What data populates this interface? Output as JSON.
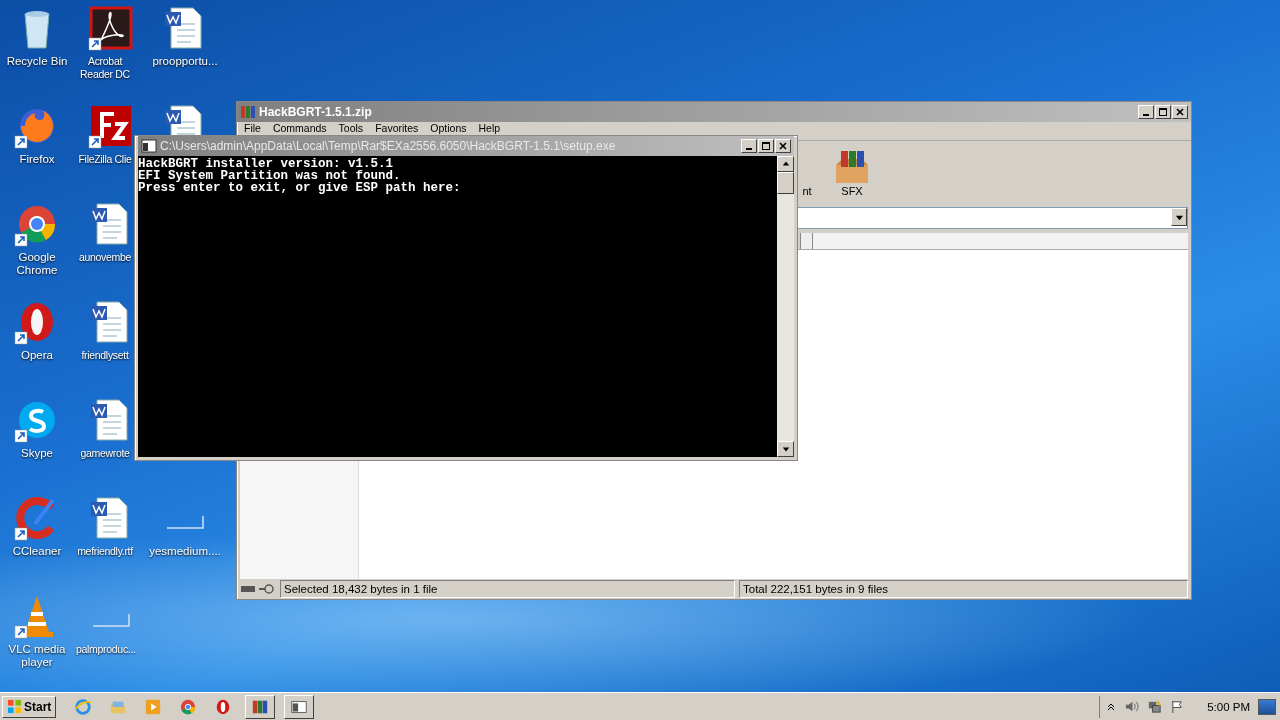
{
  "desktop": {
    "columns": [
      [
        {
          "kind": "recycle",
          "label": "Recycle Bin",
          "shortcut": false
        },
        {
          "kind": "firefox",
          "label": "Firefox",
          "shortcut": true
        },
        {
          "kind": "chrome",
          "label": "Google Chrome",
          "shortcut": true
        },
        {
          "kind": "opera",
          "label": "Opera",
          "shortcut": true
        },
        {
          "kind": "skype",
          "label": "Skype",
          "shortcut": true
        },
        {
          "kind": "ccleaner",
          "label": "CCleaner",
          "shortcut": true
        },
        {
          "kind": "vlc",
          "label": "VLC media player",
          "shortcut": true
        }
      ],
      [
        {
          "kind": "acrobat",
          "label": "Acrobat Reader DC",
          "shortcut": true
        },
        {
          "kind": "filezilla",
          "label": "FileZilla Clie",
          "shortcut": true
        },
        {
          "kind": "word",
          "label": "aunovembe",
          "shortcut": false
        },
        {
          "kind": "word",
          "label": "friendlysett",
          "shortcut": false
        },
        {
          "kind": "word",
          "label": "gamewrote",
          "shortcut": false
        },
        {
          "kind": "word",
          "label": "mefriendly.rtf",
          "shortcut": false
        },
        {
          "kind": "blank",
          "label": "palmproduc...",
          "shortcut": false
        }
      ],
      [
        {
          "kind": "word",
          "label": "proopportu...",
          "shortcut": false
        },
        {
          "kind": "word"
        },
        {
          "kind": "empty"
        },
        {
          "kind": "empty"
        },
        {
          "kind": "empty"
        },
        {
          "kind": "blank",
          "label": "yesmedium....",
          "shortcut": false
        }
      ]
    ]
  },
  "archive_window": {
    "title": "HackBGRT-1.5.1.zip",
    "menu": [
      "File",
      "Commands",
      "Tools",
      "Favorites",
      "Options",
      "Help"
    ],
    "toolbar": [
      {
        "label": "nt",
        "kind": "hidden"
      },
      {
        "label": "SFX",
        "kind": "sfx"
      }
    ],
    "status_bar": {
      "left": "Selected 18,432 bytes in 1 file",
      "right": "Total 222,151 bytes in 9 files"
    }
  },
  "console_window": {
    "title": "C:\\Users\\admin\\AppData\\Local\\Temp\\Rar$EXa2556.6050\\HackBGRT-1.5.1\\setup.exe",
    "lines": [
      "HackBGRT installer version: v1.5.1",
      "EFI System Partition was not found.",
      "Press enter to exit, or give ESP path here:"
    ]
  },
  "taskbar": {
    "start": "Start",
    "items": [
      {
        "kind": "ie",
        "selected": false
      },
      {
        "kind": "folder",
        "selected": false
      },
      {
        "kind": "media",
        "selected": false
      },
      {
        "kind": "chrome",
        "selected": false
      },
      {
        "kind": "opera",
        "selected": false
      },
      {
        "kind": "winrar",
        "selected": true
      },
      {
        "kind": "console",
        "selected": true
      }
    ],
    "clock": "5:00 PM"
  }
}
